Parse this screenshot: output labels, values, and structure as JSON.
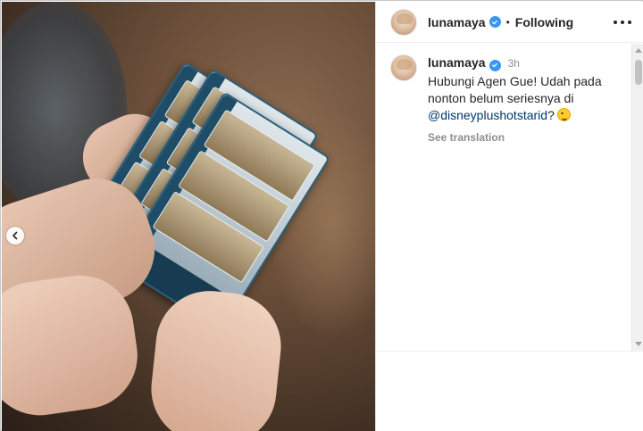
{
  "post": {
    "username": "lunamaya",
    "separator": "•",
    "follow_status": "Following"
  },
  "caption": {
    "username": "lunamaya",
    "time": "3h",
    "text": "Hubungi Agen Gue! Udah pada nonton belum seriesnya di",
    "mention": "@disneyplushotstarid",
    "suffix": "?",
    "see_translation": "See translation"
  },
  "icons": {
    "verified": "verified-badge-icon",
    "more": "more-options-icon",
    "carousel_prev": "chevron-left-icon",
    "emoji": "smirk-emoji-icon"
  },
  "colors": {
    "verified": "#3897f0",
    "mention": "#00376b",
    "muted": "#8e8e8e"
  }
}
